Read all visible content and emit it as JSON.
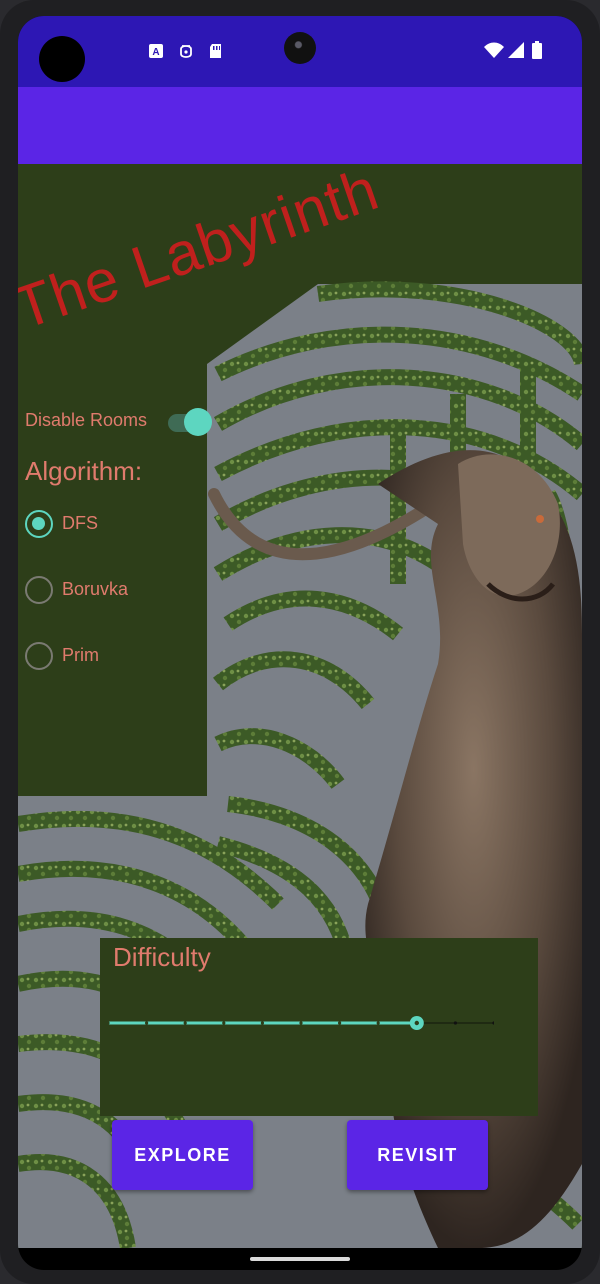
{
  "app": {
    "title": "The Labyrinth"
  },
  "status_bar": {
    "icons": [
      "a-box-icon",
      "bug-icon",
      "sd-card-icon",
      "wifi-icon",
      "signal-icon",
      "battery-icon"
    ]
  },
  "settings": {
    "disable_rooms_label": "Disable Rooms",
    "disable_rooms_on": true,
    "algorithm_heading": "Algorithm:",
    "algorithms": [
      {
        "label": "DFS",
        "selected": true
      },
      {
        "label": "Boruvka",
        "selected": false
      },
      {
        "label": "Prim",
        "selected": false
      }
    ]
  },
  "difficulty": {
    "label": "Difficulty",
    "value": 8,
    "min": 0,
    "max": 10
  },
  "buttons": {
    "explore": "EXPLORE",
    "revisit": "REVISIT"
  },
  "colors": {
    "accent": "#5dd6c0",
    "primary": "#5b25e6",
    "status_bar": "#2d17b4",
    "panel": "#2d3e19",
    "title": "#c0201d",
    "text": "#e07b6d"
  }
}
